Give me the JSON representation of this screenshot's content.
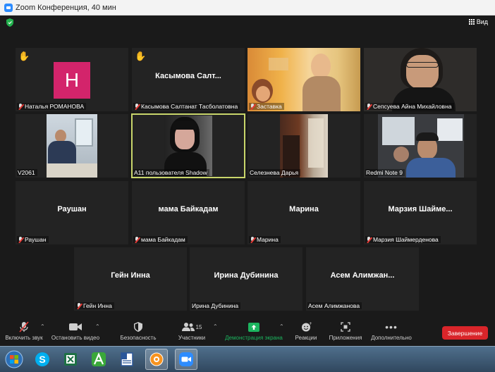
{
  "window": {
    "title": "Zoom Конференция, 40 мин"
  },
  "view_button": {
    "label": "Вид"
  },
  "tiles": [
    {
      "name": "Наталья РОМАНОВА",
      "muted": true,
      "hand": true,
      "avatar_letter": "H"
    },
    {
      "name": "Касымова Салтанат Тасболатовна",
      "display": "Касымова  Салт...",
      "muted": true,
      "hand": true
    },
    {
      "name": "Заставка",
      "muted": true
    },
    {
      "name": "Сепсуева Айна Михайловна",
      "muted": true
    },
    {
      "name": "V2061",
      "muted": false
    },
    {
      "name": "A11 пользователя Shadow",
      "muted": false,
      "active": true
    },
    {
      "name": "Селезнева Дарья",
      "muted": false
    },
    {
      "name": "Redmi Note 9",
      "muted": false
    },
    {
      "name": "Раушан",
      "display": "Раушан",
      "muted": true
    },
    {
      "name": "мама Байкадам",
      "display": "мама Байкадам",
      "muted": true
    },
    {
      "name": "Марина",
      "display": "Марина",
      "muted": true
    },
    {
      "name": "Марзия Шаймерденова",
      "display": "Марзия  Шайме...",
      "muted": true
    },
    {
      "name": "Гейн Инна",
      "display": "Гейн Инна",
      "muted": true
    },
    {
      "name": "Ирина Дубинина",
      "display": "Ирина Дубинина",
      "muted": false
    },
    {
      "name": "Асем Алимжанова",
      "display": "Асем  Алимжан...",
      "muted": false
    }
  ],
  "toolbar": {
    "unmute": "Включить звук",
    "stop_video": "Остановить видео",
    "security": "Безопасность",
    "participants": "Участники",
    "participants_count": "15",
    "share": "Демонстрация экрана",
    "reactions": "Реакции",
    "apps": "Приложения",
    "more": "Дополнительно",
    "end": "Завершение"
  },
  "colors": {
    "accent_green": "#1cb55f",
    "end_red": "#d9252a",
    "avatar_pink": "#d3246b",
    "active_outline": "#c9d66b",
    "hand_yellow": "#ffc21a"
  }
}
